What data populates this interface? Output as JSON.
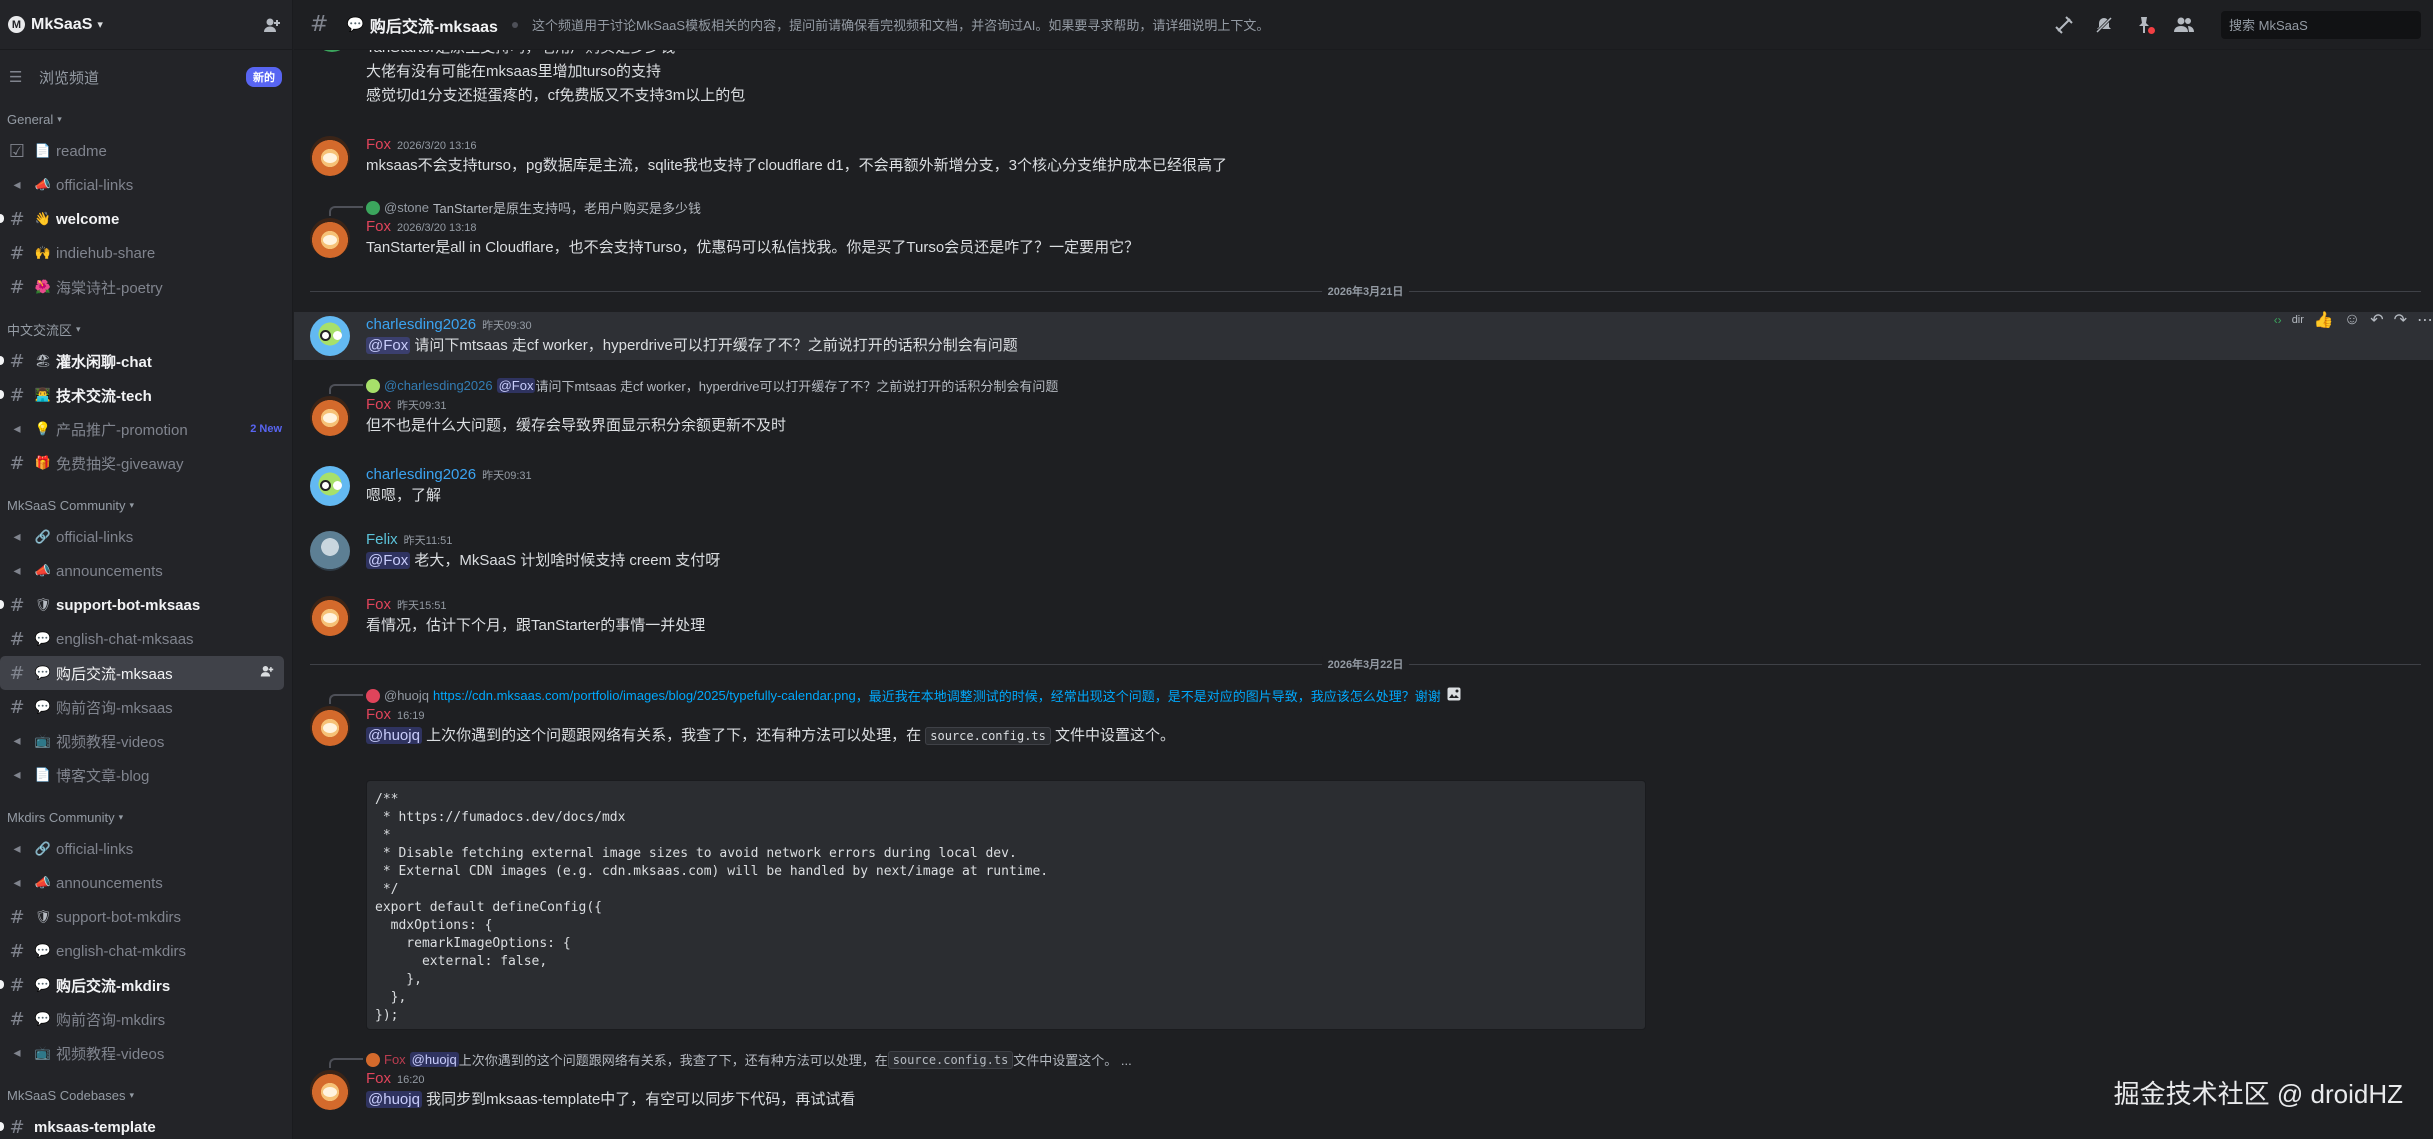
{
  "server": {
    "name": "MkSaaS",
    "logo_glyph": "M"
  },
  "browse": {
    "label": "浏览频道",
    "badge": "新的"
  },
  "categories": [
    {
      "name": "General",
      "channels": [
        {
          "icon": "rules-icon",
          "emoji": "📄",
          "name": "readme",
          "state": "read"
        },
        {
          "icon": "megaphone-icon",
          "emoji": "📣",
          "name": "official-links",
          "state": "read"
        },
        {
          "icon": "hash-icon",
          "emoji": "👋",
          "name": "welcome",
          "state": "unread"
        },
        {
          "icon": "hash-icon",
          "emoji": "🙌",
          "name": "indiehub-share",
          "state": "read"
        },
        {
          "icon": "hash-icon",
          "emoji": "🌺",
          "name": "海棠诗社-poetry",
          "state": "read"
        }
      ]
    },
    {
      "name": "中文交流区",
      "channels": [
        {
          "icon": "hash-icon",
          "emoji": "🏖",
          "name": "灌水闲聊-chat",
          "state": "unread"
        },
        {
          "icon": "hash-icon",
          "emoji": "👨‍💻",
          "name": "技术交流-tech",
          "state": "unread"
        },
        {
          "icon": "forum-icon",
          "emoji": "💡",
          "name": "产品推广-promotion",
          "state": "read",
          "badge": "2 New"
        },
        {
          "icon": "hash-icon",
          "emoji": "🎁",
          "name": "免费抽奖-giveaway",
          "state": "read"
        }
      ]
    },
    {
      "name": "MkSaaS Community",
      "channels": [
        {
          "icon": "megaphone-icon",
          "emoji": "🔗",
          "name": "official-links",
          "state": "read"
        },
        {
          "icon": "megaphone-icon",
          "emoji": "📣",
          "name": "announcements",
          "state": "read"
        },
        {
          "icon": "hash-icon",
          "emoji": "🛡",
          "name": "support-bot-mksaas",
          "state": "unread"
        },
        {
          "icon": "hash-icon",
          "emoji": "💬",
          "name": "english-chat-mksaas",
          "state": "read"
        },
        {
          "icon": "hash-icon",
          "emoji": "💬",
          "name": "购后交流-mksaas",
          "state": "active"
        },
        {
          "icon": "hash-icon",
          "emoji": "💬",
          "name": "购前咨询-mksaas",
          "state": "read"
        },
        {
          "icon": "megaphone-icon",
          "emoji": "📺",
          "name": "视频教程-videos",
          "state": "read"
        },
        {
          "icon": "megaphone-icon",
          "emoji": "📄",
          "name": "博客文章-blog",
          "state": "read"
        }
      ]
    },
    {
      "name": "Mkdirs Community",
      "channels": [
        {
          "icon": "megaphone-icon",
          "emoji": "🔗",
          "name": "official-links",
          "state": "read"
        },
        {
          "icon": "megaphone-icon",
          "emoji": "📣",
          "name": "announcements",
          "state": "read"
        },
        {
          "icon": "hash-icon",
          "emoji": "🛡",
          "name": "support-bot-mkdirs",
          "state": "read"
        },
        {
          "icon": "hash-icon",
          "emoji": "💬",
          "name": "english-chat-mkdirs",
          "state": "read"
        },
        {
          "icon": "hash-icon",
          "emoji": "💬",
          "name": "购后交流-mkdirs",
          "state": "unread"
        },
        {
          "icon": "hash-icon",
          "emoji": "💬",
          "name": "购前咨询-mkdirs",
          "state": "read"
        },
        {
          "icon": "megaphone-icon",
          "emoji": "📺",
          "name": "视频教程-videos",
          "state": "read"
        }
      ]
    },
    {
      "name": "MkSaaS Codebases",
      "channels": [
        {
          "icon": "hash-icon",
          "emoji": "",
          "name": "mksaas-template",
          "state": "unread"
        }
      ]
    }
  ],
  "topbar": {
    "emoji": "💬",
    "channel_name": "购后交流-mksaas",
    "topic": "这个频道用于讨论MkSaaS模板相关的内容，提问前请确保看完视频和文档，并咨询过AI。如果要寻求帮助，请详细说明上下文。",
    "search_placeholder": "搜索 MkSaaS"
  },
  "messages": {
    "top_lines": [
      "TanStarter是原生支持吗，老用户购买是多少钱",
      "大佬有没有可能在mksaas里增加turso的支持",
      "感觉切d1分支还挺蛋疼的，cf免费版又不支持3m以上的包"
    ],
    "m1": {
      "author": "Fox",
      "time": "2026/3/20 13:16",
      "text": "mksaas不会支持turso，pg数据库是主流，sqlite我也支持了cloudflare d1，不会再额外新增分支，3个核心分支维护成本已经很高了"
    },
    "m2": {
      "reply_author": "@stone",
      "reply_text": "TanStarter是原生支持吗，老用户购买是多少钱",
      "author": "Fox",
      "time": "2026/3/20 13:18",
      "text": "TanStarter是all in Cloudflare，也不会支持Turso，优惠码可以私信找我。你是买了Turso会员还是咋了？一定要用它？"
    },
    "day1": "2026年3月21日",
    "m3": {
      "author": "charlesding2026",
      "time": "昨天09:30",
      "mention": "@Fox",
      "text": " 请问下mtsaas 走cf worker，hyperdrive可以打开缓存了不？之前说打开的话积分制会有问题"
    },
    "m4": {
      "reply_author": "@charlesding2026",
      "reply_mention": "@Fox",
      "reply_text": " 请问下mtsaas 走cf worker，hyperdrive可以打开缓存了不？之前说打开的话积分制会有问题",
      "author": "Fox",
      "time": "昨天09:31",
      "text": "但不也是什么大问题，缓存会导致界面显示积分余额更新不及时"
    },
    "m5": {
      "author": "charlesding2026",
      "time": "昨天09:31",
      "text": "嗯嗯，了解"
    },
    "m6": {
      "author": "Felix",
      "time": "昨天11:51",
      "mention": "@Fox",
      "text": " 老大，MkSaaS 计划啥时候支持 creem 支付呀"
    },
    "m7": {
      "author": "Fox",
      "time": "昨天15:51",
      "text": "看情况，估计下个月，跟TanStarter的事情一并处理"
    },
    "day2": "2026年3月22日",
    "m8": {
      "reply_author": "@huojq",
      "reply_link": "https://cdn.mksaas.com/portfolio/images/blog/2025/typefully-calendar.png",
      "reply_text": "，最近我在本地调整测试的时候，经常出现这个问题，是不是对应的图片导致，我应该怎么处理？谢谢",
      "author": "Fox",
      "time": "16:19",
      "mention": "@huojq",
      "text_a": " 上次你遇到的这个问题跟网络有关系，我查了下，还有种方法可以处理，在 ",
      "code": "source.config.ts",
      "text_b": " 文件中设置这个。"
    },
    "codeblock": "/**\n * https://fumadocs.dev/docs/mdx\n *\n * Disable fetching external image sizes to avoid network errors during local dev.\n * External CDN images (e.g. cdn.mksaas.com) will be handled by next/image at runtime.\n */\nexport default defineConfig({\n  mdxOptions: {\n    remarkImageOptions: {\n      external: false,\n    },\n  },\n});",
    "m9": {
      "reply_author": "Fox",
      "reply_mention": "@huojq",
      "reply_text_a": " 上次你遇到的这个问题跟网络有关系，我查了下，还有种方法可以处理，在 ",
      "reply_code": "source.config.ts",
      "reply_text_b": " 文件中设置这个。 ...",
      "author": "Fox",
      "time": "16:20",
      "mention": "@huojq",
      "text": " 我同步到mksaas-template中了，有空可以同步下代码，再试试看"
    }
  },
  "watermark": "掘金技术社区 @ droidHZ",
  "colors": {
    "accent": "#5865f2",
    "fox": "#e0445b",
    "charles": "#3ba3f0",
    "felix": "#5bc2d9",
    "link": "#00a8fc"
  }
}
